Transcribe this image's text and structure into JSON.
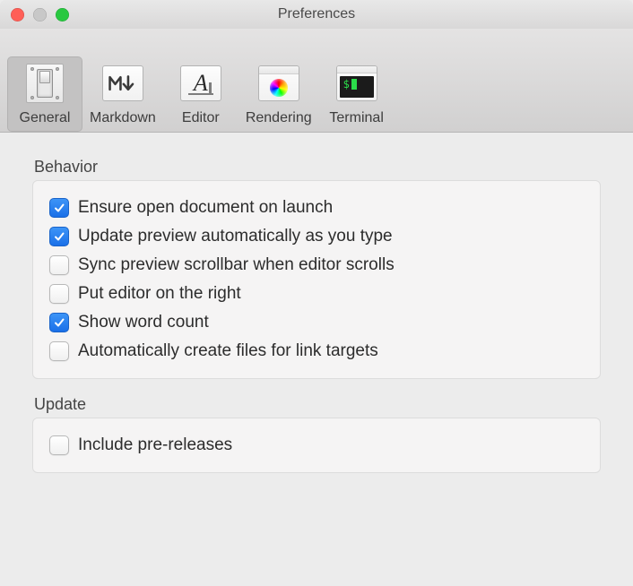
{
  "window": {
    "title": "Preferences"
  },
  "tabs": [
    {
      "id": "general",
      "label": "General",
      "selected": true
    },
    {
      "id": "markdown",
      "label": "Markdown",
      "selected": false
    },
    {
      "id": "editor",
      "label": "Editor",
      "selected": false
    },
    {
      "id": "rendering",
      "label": "Rendering",
      "selected": false
    },
    {
      "id": "terminal",
      "label": "Terminal",
      "selected": false
    }
  ],
  "sections": {
    "behavior": {
      "label": "Behavior",
      "items": [
        {
          "id": "ensure_open_doc",
          "label": "Ensure open document on launch",
          "checked": true
        },
        {
          "id": "auto_update_preview",
          "label": "Update preview automatically as you type",
          "checked": true
        },
        {
          "id": "sync_scrollbar",
          "label": "Sync preview scrollbar when editor scrolls",
          "checked": false
        },
        {
          "id": "editor_on_right",
          "label": "Put editor on the right",
          "checked": false
        },
        {
          "id": "show_word_count",
          "label": "Show word count",
          "checked": true
        },
        {
          "id": "auto_create_files",
          "label": "Automatically create files for link targets",
          "checked": false
        }
      ]
    },
    "update": {
      "label": "Update",
      "items": [
        {
          "id": "include_prereleases",
          "label": "Include pre-releases",
          "checked": false
        }
      ]
    }
  }
}
